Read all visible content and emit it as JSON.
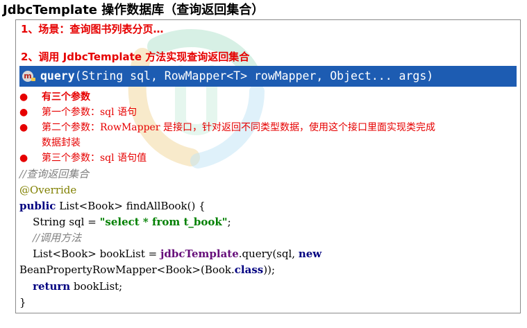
{
  "title": "JdbcTemplate 操作数据库（查询返回集合）",
  "section1": "1、场景：查询图书列表分页…",
  "section2": "2、调用 JdbcTemplate 方法实现查询返回集合",
  "hint": {
    "icon_letter": "m",
    "method": "query",
    "signature": "(String sql, RowMapper<T> rowMapper, Object... args)",
    "bg_color": "#1d5cb2"
  },
  "bullets": {
    "dot": "●",
    "b1": "有三个参数",
    "b2": "第一个参数：sql 语句",
    "b3": "第二个参数：RowMapper 是接口，针对返回不同类型数据，使用这个接口里面实现类完成",
    "b3_cont": "数据封装",
    "b4": "第三个参数：sql 语句值"
  },
  "code": {
    "comment1": "//查询返回集合",
    "annotation": "@Override",
    "kw_public": "public",
    "sig_rest": " List<Book> findAllBook() {",
    "indent": "    ",
    "sql_decl": "String sql = ",
    "sql_str": "\"select * from t_book\"",
    "semi": ";",
    "comment2": "//调用方法",
    "list_decl": "List<Book> bookList = ",
    "field": "jdbcTemplate",
    "query_call": ".query(sql, ",
    "kw_new": "new",
    "mapper": "BeanPropertyRowMapper<Book>(Book.",
    "kw_class": "class",
    "mapper_end": "));",
    "kw_return": "return",
    "return_rest": " bookList;",
    "close": "}"
  }
}
